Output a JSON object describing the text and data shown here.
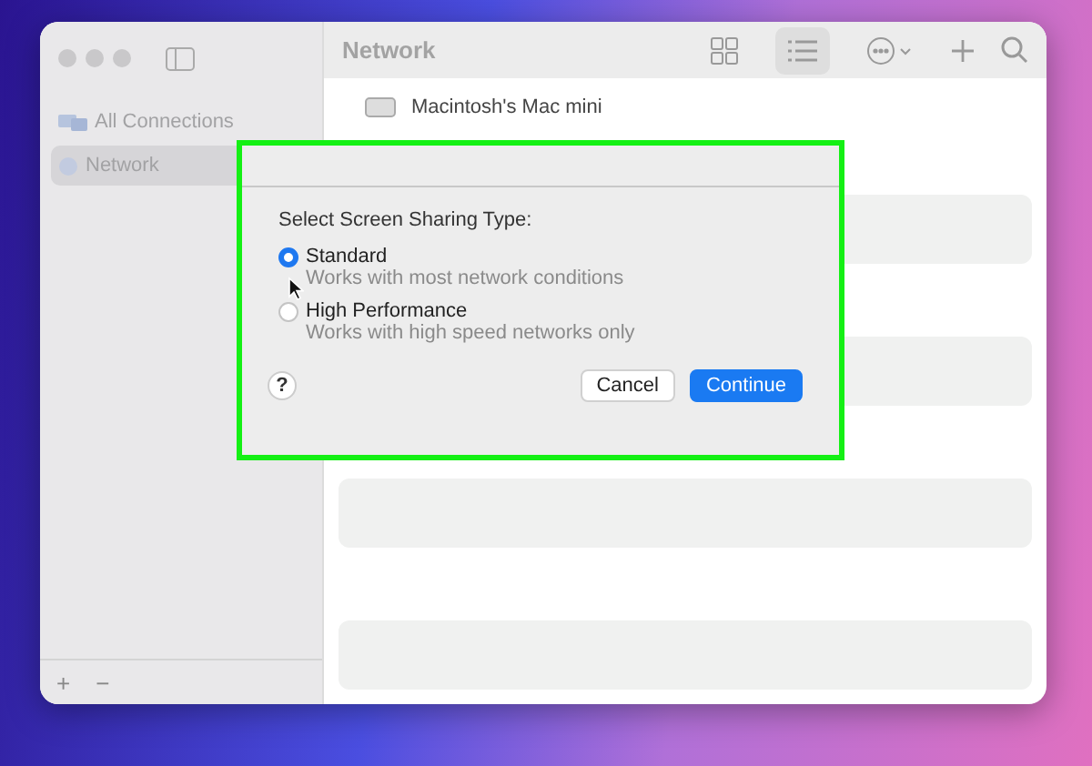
{
  "window": {
    "title": "Network"
  },
  "sidebar": {
    "items": [
      {
        "label": "All Connections",
        "selected": false
      },
      {
        "label": "Network",
        "selected": true
      }
    ],
    "footer_buttons": [
      "+",
      "−"
    ]
  },
  "content": {
    "items": [
      {
        "name": "Macintosh's Mac mini"
      }
    ]
  },
  "dialog": {
    "prompt": "Select Screen Sharing Type:",
    "options": [
      {
        "label": "Standard",
        "description": "Works with most network conditions",
        "selected": true
      },
      {
        "label": "High Performance",
        "description": "Works with high speed networks only",
        "selected": false
      }
    ],
    "help": "?",
    "buttons": [
      {
        "label": "Cancel",
        "primary": false
      },
      {
        "label": "Continue",
        "primary": true
      }
    ]
  }
}
